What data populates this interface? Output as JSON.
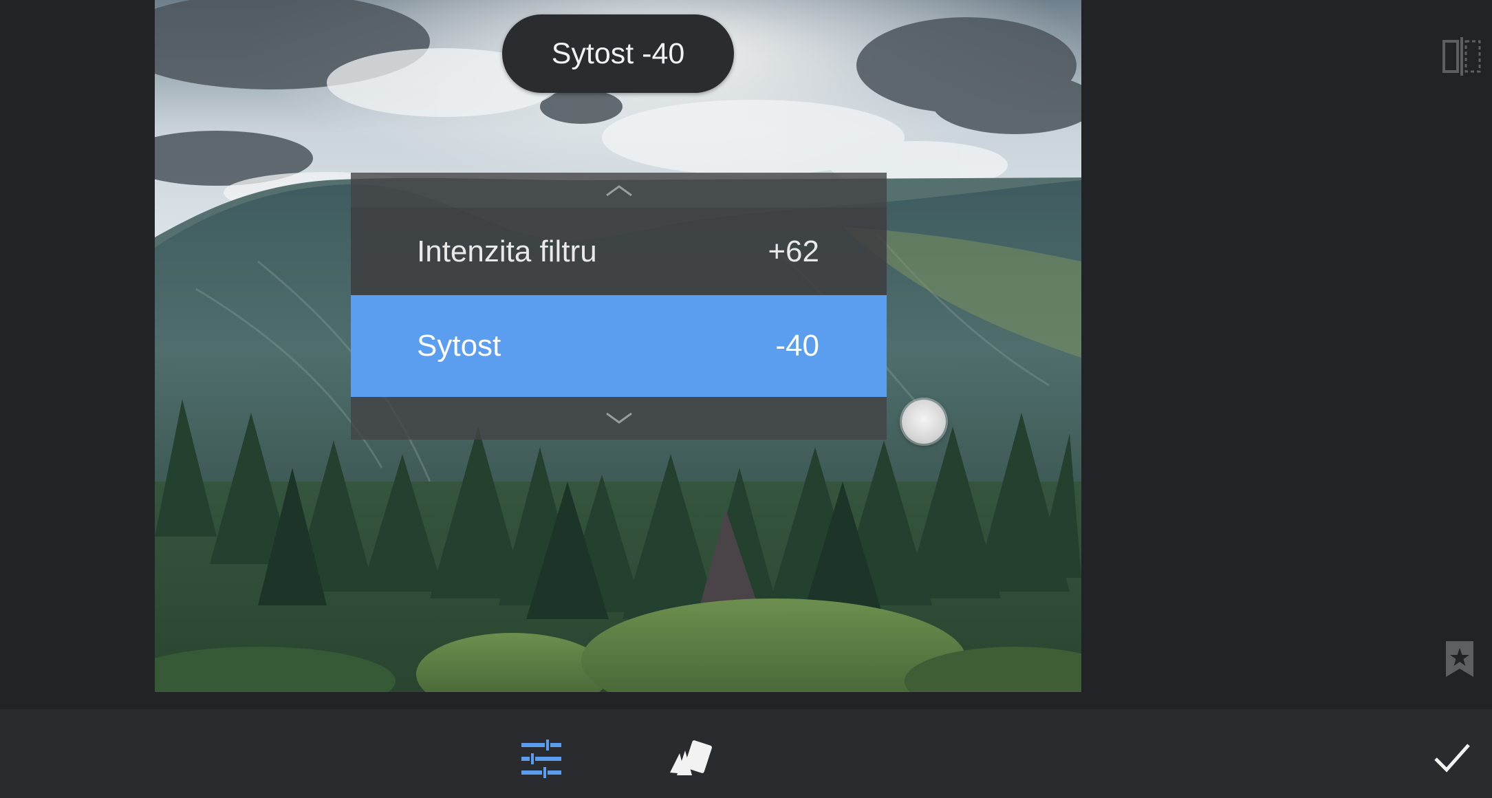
{
  "tooltip": {
    "text": "Sytost -40"
  },
  "menu": {
    "items": [
      {
        "label": "Intenzita filtru",
        "value": "+62",
        "selected": false
      },
      {
        "label": "Sytost",
        "value": "-40",
        "selected": true
      }
    ]
  },
  "icons": {
    "up": "chevron-up-icon",
    "down": "chevron-down-icon",
    "compare": "compare-split-icon",
    "bookmark": "bookmark-star-icon",
    "adjust": "sliders-tune-icon",
    "styles": "style-cards-icon",
    "apply": "checkmark-icon",
    "point": "control-point-icon"
  },
  "colors": {
    "accent": "#5b9ef0",
    "background": "#222326",
    "toolbar": "#2a2b2e",
    "menu": "#3e3e40"
  }
}
